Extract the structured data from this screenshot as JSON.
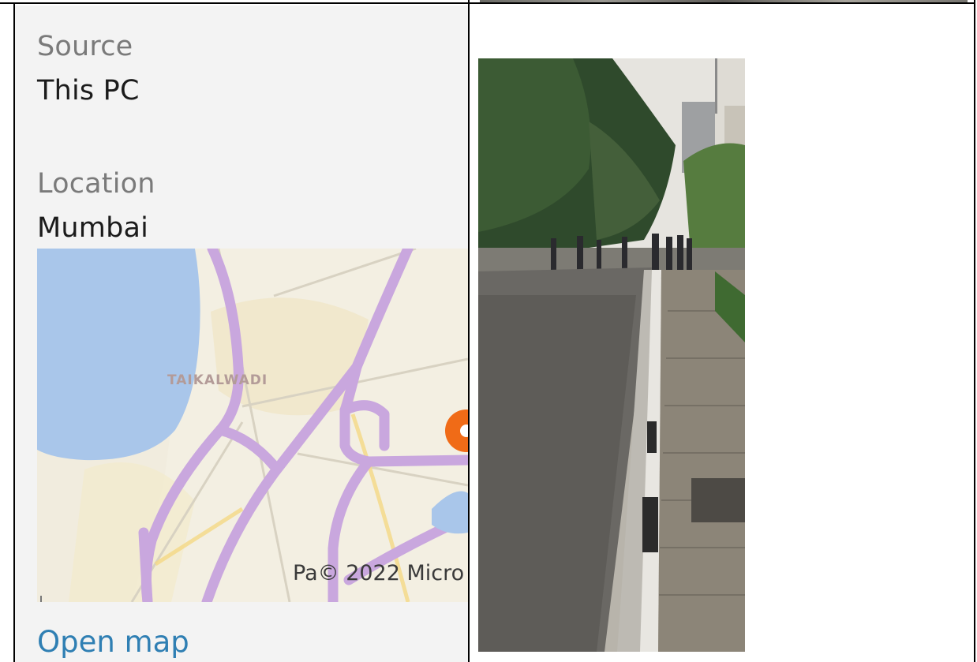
{
  "details": {
    "source_label": "Source",
    "source_value": "This PC",
    "location_label": "Location",
    "location_value": "Mumbai",
    "open_map_label": "Open map"
  },
  "map": {
    "place_label": "TAIKALWADI",
    "attribution": "Pa© 2022 Micro",
    "water_color": "#a9c6ea",
    "road_color": "#c9a7de",
    "pin_color": "#f06b17"
  }
}
